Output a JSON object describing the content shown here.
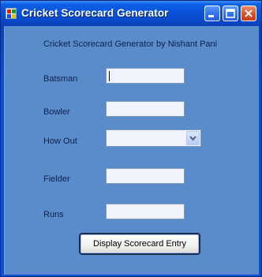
{
  "window": {
    "title": "Cricket Scorecard Generator"
  },
  "form": {
    "heading": "Cricket Scorecard Generator by Nishant Pani",
    "batsman_label": "Batsman",
    "batsman_value": "",
    "bowler_label": "Bowler",
    "bowler_value": "",
    "how_out_label": "How Out",
    "how_out_value": "",
    "fielder_label": "Fielder",
    "fielder_value": "",
    "runs_label": "Runs",
    "runs_value": "",
    "submit_label": "Display Scorecard Entry"
  },
  "colors": {
    "titlebar": "#0a4fd4",
    "client_background": "#5a8ccc",
    "close_button": "#d8542a"
  }
}
